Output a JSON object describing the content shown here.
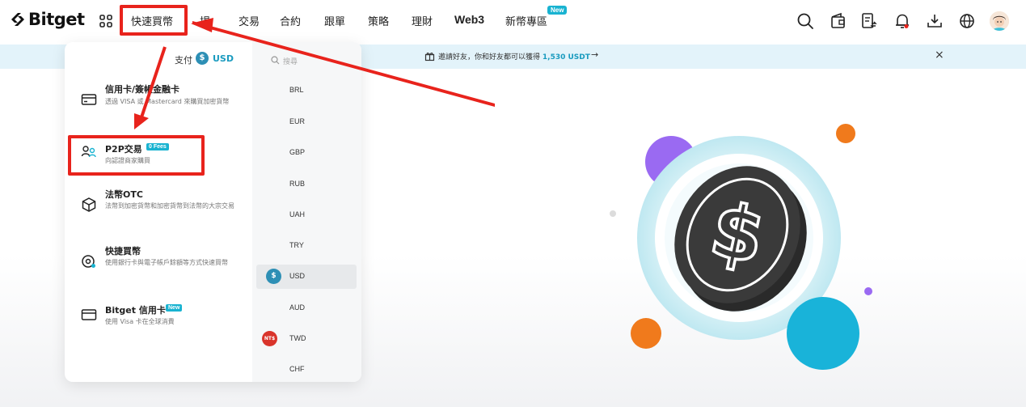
{
  "nav": {
    "logo": "Bitget",
    "items": [
      {
        "label": "快速買幣"
      },
      {
        "label": "交易"
      },
      {
        "label": "合約"
      },
      {
        "label": "跟單"
      },
      {
        "label": "策略"
      },
      {
        "label": "理財"
      },
      {
        "label": "Web3"
      },
      {
        "label": "新幣專區"
      }
    ],
    "partial_item": "場",
    "new_badge": "New",
    "icons": [
      "search-icon",
      "wallet-icon",
      "orders-icon",
      "bell-icon",
      "download-icon",
      "globe-icon",
      "avatar"
    ]
  },
  "banner": {
    "text": "邀請好友，你和好友都可以獲得",
    "amount": "1,530 USDT",
    "arrow": "→",
    "close": "×"
  },
  "dropdown": {
    "pay_label": "支付",
    "pay_currency": "USD",
    "menu": [
      {
        "title": "信用卡/簽帳金融卡",
        "desc": "透過 VISA 或 Mastercard 來購買加密貨幣",
        "icon": "credit-card-icon"
      },
      {
        "title": "P2P交易",
        "badge": "0 Fees",
        "desc": "向認證商家購買",
        "icon": "p2p-users-icon"
      },
      {
        "title": "法幣OTC",
        "desc": "法幣到加密貨幣和加密貨幣到法幣的大宗交易",
        "icon": "cube-icon"
      },
      {
        "title": "快捷買幣",
        "desc": "使用銀行卡與電子帳戶餘額等方式快速買幣",
        "icon": "quick-buy-icon"
      },
      {
        "title": "Bitget 信用卡",
        "badge": "New",
        "desc": "使用 Visa 卡在全球消費",
        "icon": "bitget-card-icon"
      }
    ],
    "search_placeholder": "搜尋",
    "currencies": [
      {
        "code": "BRL"
      },
      {
        "code": "EUR"
      },
      {
        "code": "GBP"
      },
      {
        "code": "RUB"
      },
      {
        "code": "UAH"
      },
      {
        "code": "TRY"
      },
      {
        "code": "USD",
        "selected": true,
        "coin": "$"
      },
      {
        "code": "AUD"
      },
      {
        "code": "TWD",
        "coin": "NT$"
      },
      {
        "code": "CHF"
      }
    ]
  },
  "colors": {
    "accent": "#19b3d1",
    "highlight": "#e8231c",
    "banner_bg": "#e3f3fa"
  }
}
